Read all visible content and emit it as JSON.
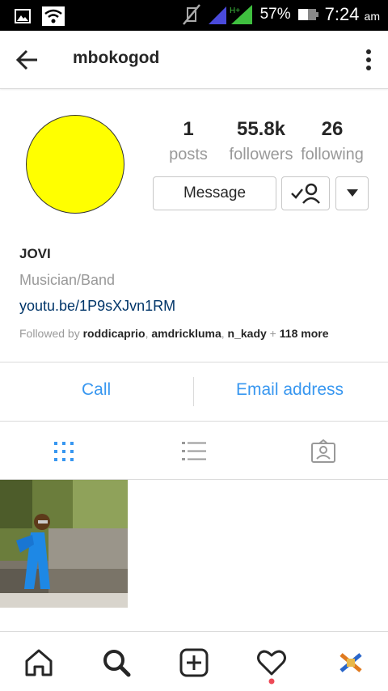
{
  "status_bar": {
    "battery": "57%",
    "time": "7:24",
    "ampm": "am",
    "network": "H+",
    "icons": [
      "image-icon",
      "wifi-icon",
      "mute-icon",
      "signal-icon",
      "battery-icon"
    ]
  },
  "header": {
    "username": "mbokogod",
    "back_icon": "arrow-left-icon",
    "more_icon": "vertical-dots-icon"
  },
  "profile": {
    "avatar_color": "#ffff00",
    "stats": {
      "posts_value": "1",
      "posts_label": "posts",
      "followers_value": "55.8k",
      "followers_label": "followers",
      "following_value": "26",
      "following_label": "following"
    },
    "message_label": "Message",
    "name": "JOVI",
    "category": "Musician/Band",
    "link": "youtu.be/1P9sXJvn1RM",
    "followed_by": {
      "prefix": "Followed by ",
      "user1": "roddicaprio",
      "sep1": ", ",
      "user2": "amdrickluma",
      "sep2": ", ",
      "user3": "n_kady",
      "suffix_plus": " + ",
      "more": "118 more"
    }
  },
  "contact": {
    "call_label": "Call",
    "email_label": "Email address",
    "accent": "#3897f0"
  },
  "tabs": [
    "grid-icon",
    "list-icon",
    "tagged-icon"
  ],
  "bottom_nav": [
    "home-icon",
    "search-icon",
    "add-icon",
    "heart-icon",
    "profile-avatar-icon"
  ],
  "notification_dot_color": "#ed4956"
}
